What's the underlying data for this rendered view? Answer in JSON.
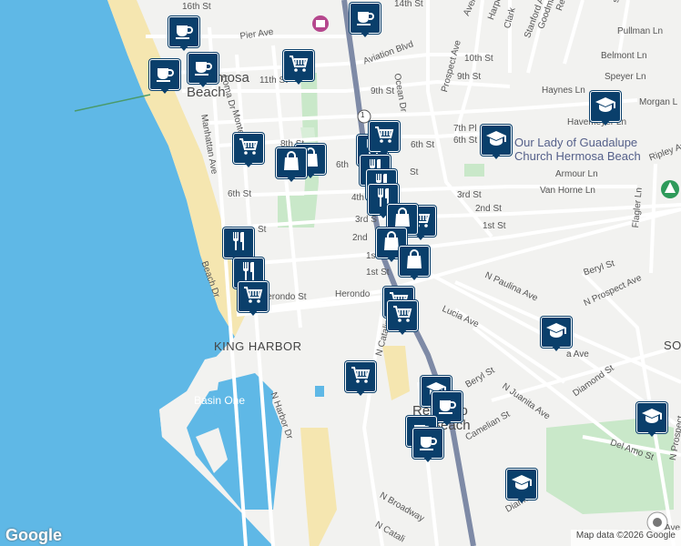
{
  "map": {
    "places": {
      "hermosa_beach_1": "Hermosa",
      "hermosa_beach_2": "Beach",
      "redondo_1": "Redondo",
      "redondo_2": "Beach",
      "king_harbor": "KING HARBOR",
      "basin_one": "Basin One",
      "church_1": "Our Lady of Guadalupe",
      "church_2": "Church Hermosa Beach",
      "south_bay_partial": "SO"
    },
    "streets": [
      {
        "id": "s1",
        "text": "16th St"
      },
      {
        "id": "s2",
        "text": "14th St"
      },
      {
        "id": "s3",
        "text": "Pier Ave"
      },
      {
        "id": "s4",
        "text": "Aviation Blvd"
      },
      {
        "id": "s5",
        "text": "11th St"
      },
      {
        "id": "s6",
        "text": "10th St"
      },
      {
        "id": "s7",
        "text": "9th St"
      },
      {
        "id": "s8",
        "text": "9th St"
      },
      {
        "id": "s9",
        "text": "Ocean Dr"
      },
      {
        "id": "s10",
        "text": "Prospect Ave"
      },
      {
        "id": "s11",
        "text": "Pullman Ln"
      },
      {
        "id": "s12",
        "text": "Belmont Ln"
      },
      {
        "id": "s13",
        "text": "Speyer Ln"
      },
      {
        "id": "s14",
        "text": "Haynes Ln"
      },
      {
        "id": "s15",
        "text": "Morgan L"
      },
      {
        "id": "s16",
        "text": "Havemeyer Ln"
      },
      {
        "id": "s17",
        "text": "7th Pl"
      },
      {
        "id": "s18",
        "text": "6th St"
      },
      {
        "id": "s19",
        "text": "6th St"
      },
      {
        "id": "s20",
        "text": "Armour Ln"
      },
      {
        "id": "s21",
        "text": "Van Horne Ln"
      },
      {
        "id": "s22",
        "text": "Ripley Av"
      },
      {
        "id": "s23",
        "text": "Flagler Ln"
      },
      {
        "id": "s24",
        "text": "3rd St"
      },
      {
        "id": "s25",
        "text": "2nd St"
      },
      {
        "id": "s26",
        "text": "1st St"
      },
      {
        "id": "s27",
        "text": "2nd"
      },
      {
        "id": "s28",
        "text": "1st St"
      },
      {
        "id": "s29",
        "text": "Herondo"
      },
      {
        "id": "s30",
        "text": "N Paulina Ave"
      },
      {
        "id": "s31",
        "text": "Beryl St"
      },
      {
        "id": "s32",
        "text": "N Prospect Ave"
      },
      {
        "id": "s33",
        "text": "Lucia Ave"
      },
      {
        "id": "s34",
        "text": "Beryl St"
      },
      {
        "id": "s35",
        "text": "N Juanita Ave"
      },
      {
        "id": "s36",
        "text": "Diamond St"
      },
      {
        "id": "s37",
        "text": "Del Amo St"
      },
      {
        "id": "s38",
        "text": "Camelian St"
      },
      {
        "id": "s39",
        "text": "N Broadway"
      },
      {
        "id": "s40",
        "text": "N Catalina"
      },
      {
        "id": "s41",
        "text": "N Catali"
      },
      {
        "id": "s42",
        "text": "Diamo"
      },
      {
        "id": "s43",
        "text": "N Harbor Dr"
      },
      {
        "id": "s44",
        "text": "Herondo St"
      },
      {
        "id": "s45",
        "text": "Beach Dr"
      },
      {
        "id": "s46",
        "text": "Loma Dr"
      },
      {
        "id": "s47",
        "text": "Manhattan Ave"
      },
      {
        "id": "s48",
        "text": "Monte"
      },
      {
        "id": "s49",
        "text": "6th St"
      },
      {
        "id": "s50",
        "text": "8th St"
      },
      {
        "id": "s51",
        "text": "6th"
      },
      {
        "id": "s52",
        "text": "4th"
      },
      {
        "id": "s53",
        "text": "3rd S"
      },
      {
        "id": "s54",
        "text": "1st"
      },
      {
        "id": "s55",
        "text": "St"
      },
      {
        "id": "s56",
        "text": "St"
      },
      {
        "id": "s57",
        "text": "St"
      },
      {
        "id": "s58",
        "text": "Valley"
      },
      {
        "id": "s59",
        "text": "Harper Ave"
      },
      {
        "id": "s60",
        "text": "Stanford Ave"
      },
      {
        "id": "s61",
        "text": "Goodman Ave"
      },
      {
        "id": "s62",
        "text": "Reinhart Ave"
      },
      {
        "id": "s63",
        "text": "Avenue"
      },
      {
        "id": "s64",
        "text": "Clark"
      },
      {
        "id": "s65",
        "text": "ss Ln"
      },
      {
        "id": "s66",
        "text": "N Prospect"
      },
      {
        "id": "s67",
        "text": "Ave"
      },
      {
        "id": "s68",
        "text": "a Ave"
      }
    ],
    "route_shield": "1",
    "markers": [
      {
        "id": "m1",
        "type": "coffee"
      },
      {
        "id": "m2",
        "type": "coffee"
      },
      {
        "id": "m3",
        "type": "coffee"
      },
      {
        "id": "m4",
        "type": "coffee"
      },
      {
        "id": "m5",
        "type": "cart"
      },
      {
        "id": "m6",
        "type": "cart"
      },
      {
        "id": "m7",
        "type": "bag"
      },
      {
        "id": "m8",
        "type": "bag"
      },
      {
        "id": "m9",
        "type": "restaurant"
      },
      {
        "id": "m10",
        "type": "cart"
      },
      {
        "id": "m11",
        "type": "restaurant"
      },
      {
        "id": "m12",
        "type": "restaurant"
      },
      {
        "id": "m13",
        "type": "restaurant"
      },
      {
        "id": "m14",
        "type": "cart"
      },
      {
        "id": "m15",
        "type": "bag"
      },
      {
        "id": "m16",
        "type": "bag"
      },
      {
        "id": "m17",
        "type": "school"
      },
      {
        "id": "m18",
        "type": "school"
      },
      {
        "id": "m19",
        "type": "restaurant"
      },
      {
        "id": "m20",
        "type": "restaurant"
      },
      {
        "id": "m21",
        "type": "cart"
      },
      {
        "id": "m22",
        "type": "bag"
      },
      {
        "id": "m23",
        "type": "cart"
      },
      {
        "id": "m24",
        "type": "cart"
      },
      {
        "id": "m25",
        "type": "school"
      },
      {
        "id": "m26",
        "type": "cart"
      },
      {
        "id": "m27",
        "type": "school"
      },
      {
        "id": "m28",
        "type": "coffee"
      },
      {
        "id": "m29",
        "type": "coffee"
      },
      {
        "id": "m30",
        "type": "school"
      },
      {
        "id": "m31",
        "type": "school"
      },
      {
        "id": "m32",
        "type": "coffee"
      }
    ],
    "logo": "Google",
    "attribution": "Map data ©2026 Google",
    "colors": {
      "ocean": "#5fb8e6",
      "beach": "#f5e6b0",
      "land": "#f2f2f0",
      "park": "#c9e8c9",
      "highway": "#7e8aa6",
      "marker": "#0a3f6b"
    }
  }
}
